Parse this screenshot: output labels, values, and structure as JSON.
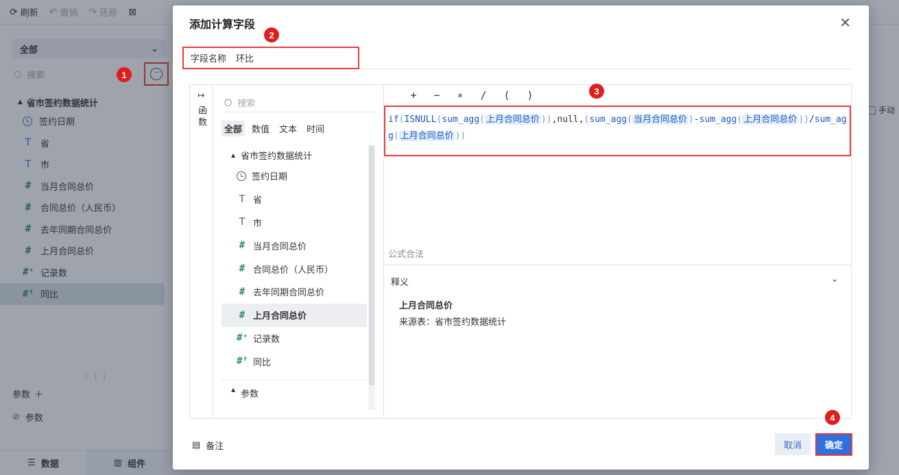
{
  "toolbar": {
    "refresh": "刷新",
    "undo": "撤销",
    "redo": "还原"
  },
  "left_panel": {
    "dataset_select": "全部",
    "search_placeholder": "搜索",
    "tree_title": "省市签约数据统计",
    "fields": [
      {
        "icon": "clock-icon",
        "label": "签约日期"
      },
      {
        "icon": "text-icon",
        "label": "省"
      },
      {
        "icon": "text-icon",
        "label": "市"
      },
      {
        "icon": "hash-icon",
        "label": "当月合同总价"
      },
      {
        "icon": "hash-icon",
        "label": "合同总价（人民币）"
      },
      {
        "icon": "hash-icon",
        "label": "去年同期合同总价"
      },
      {
        "icon": "hash-icon",
        "label": "上月合同总价"
      },
      {
        "icon": "hash-plus-icon",
        "label": "记录数"
      },
      {
        "icon": "hash-calc-icon",
        "label": "同比"
      }
    ],
    "drag_handle": "⋮⋮⋮",
    "params_label": "参数",
    "param_item": "参数",
    "tabs": [
      "数据",
      "组件"
    ]
  },
  "right_panel": {
    "manual_label": "手动"
  },
  "badges": [
    "1",
    "2",
    "3",
    "4"
  ],
  "dialog": {
    "title": "添加计算字段",
    "name_label": "字段名称",
    "name_value": "环比",
    "function_tab": "函数",
    "fields_search_placeholder": "搜索",
    "filters": [
      "全部",
      "数值",
      "文本",
      "时间"
    ],
    "tree_title": "省市签约数据统计",
    "fields": [
      {
        "icon": "clock-icon",
        "label": "签约日期"
      },
      {
        "icon": "text-icon",
        "label": "省"
      },
      {
        "icon": "text-icon",
        "label": "市"
      },
      {
        "icon": "hash-icon",
        "label": "当月合同总价"
      },
      {
        "icon": "hash-icon",
        "label": "合同总价（人民币）"
      },
      {
        "icon": "hash-icon",
        "label": "去年同期合同总价"
      },
      {
        "icon": "hash-icon",
        "label": "上月合同总价"
      },
      {
        "icon": "hash-plus-icon",
        "label": "记录数"
      },
      {
        "icon": "hash-calc-icon",
        "label": "同比"
      }
    ],
    "params_group": "参数",
    "operators": [
      "+",
      "−",
      "∗",
      "/",
      "(",
      ")"
    ],
    "formula_tokens": {
      "if": "if",
      "isnull": "ISNULL",
      "sum_agg": "sum_agg",
      "ref_last_month": "上月合同总价",
      "ref_this_month": "当月合同总价",
      "null": "null"
    },
    "formula_status": "公式合法",
    "explain_title": "释义",
    "explain_field": "上月合同总价",
    "explain_source": "来源表：省市签约数据统计",
    "note_label": "备注",
    "cancel_label": "取消",
    "ok_label": "确定"
  }
}
